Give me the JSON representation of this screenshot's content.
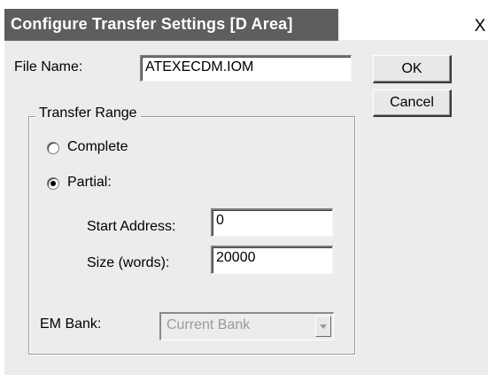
{
  "dialog": {
    "title": "Configure Transfer Settings [D Area]",
    "close_label": "X"
  },
  "file_name": {
    "label": "File Name:",
    "value": "ATEXECDM.IOM"
  },
  "buttons": {
    "ok": "OK",
    "cancel": "Cancel"
  },
  "transfer_range": {
    "legend": "Transfer Range",
    "options": [
      {
        "label": "Complete",
        "selected": false
      },
      {
        "label": "Partial:",
        "selected": true
      }
    ],
    "start_address": {
      "label": "Start Address:",
      "value": "0"
    },
    "size": {
      "label": "Size (words):",
      "value": "20000"
    }
  },
  "em_bank": {
    "label": "EM Bank:",
    "value": "Current Bank",
    "enabled": false
  }
}
